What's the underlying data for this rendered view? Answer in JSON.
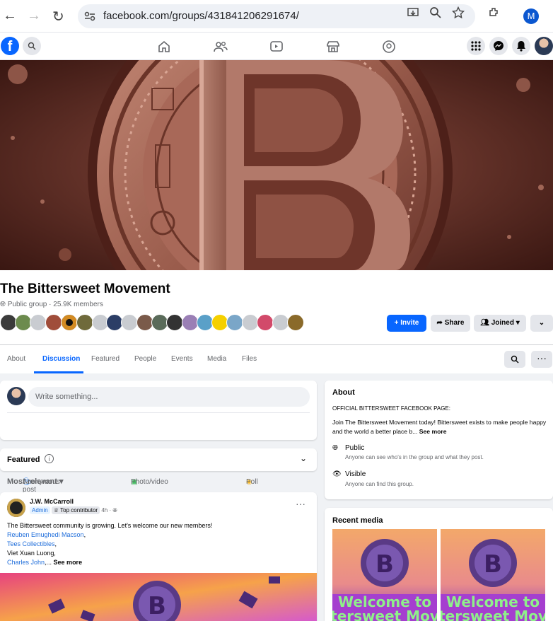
{
  "browser": {
    "url": "facebook.com/groups/431841206291674/",
    "profile_initial": "M"
  },
  "group": {
    "name": "The Bittersweet Movement",
    "meta": "Public group · 25.9K members",
    "invite_label": "Invite",
    "share_label": "Share",
    "joined_label": "Joined"
  },
  "tabs": [
    "About",
    "Discussion",
    "Featured",
    "People",
    "Events",
    "Media",
    "Files"
  ],
  "compose": {
    "placeholder": "Write something...",
    "anonymous": "Anonymous post",
    "photo": "Photo/video",
    "poll": "Poll"
  },
  "featured": {
    "title": "Featured",
    "sort": "Most relevant"
  },
  "post": {
    "author": "J.W. McCarroll",
    "role": "Admin",
    "badge": "Top contributor",
    "time": "4h ·",
    "intro": "The Bittersweet community is growing. Let's welcome our new members!",
    "mention1": "Reuben Emughedi Macson",
    "mention2": "Tees Collectibles",
    "plain1": "Viet Xuan Luong,",
    "mention3": "Charles John",
    "see_more": "See more"
  },
  "about": {
    "title": "About",
    "tagline": "OFFICIAL BITTERSWEET FACEBOOK PAGE:",
    "desc": "Join The Bittersweet Movement today! Bittersweet exists to make people happy and the world a better place b...",
    "see_more": "See more",
    "public_title": "Public",
    "public_desc": "Anyone can see who's in the group and what they post.",
    "visible_title": "Visible",
    "visible_desc": "Anyone can find this group."
  },
  "recent_media": {
    "title": "Recent media",
    "thumb_caption1": "Welcome to",
    "thumb_caption2": "tersweet Mov"
  },
  "colors": {
    "fb_blue": "#0866ff",
    "cover_brown": "#6b342b",
    "link": "#216fdb"
  }
}
